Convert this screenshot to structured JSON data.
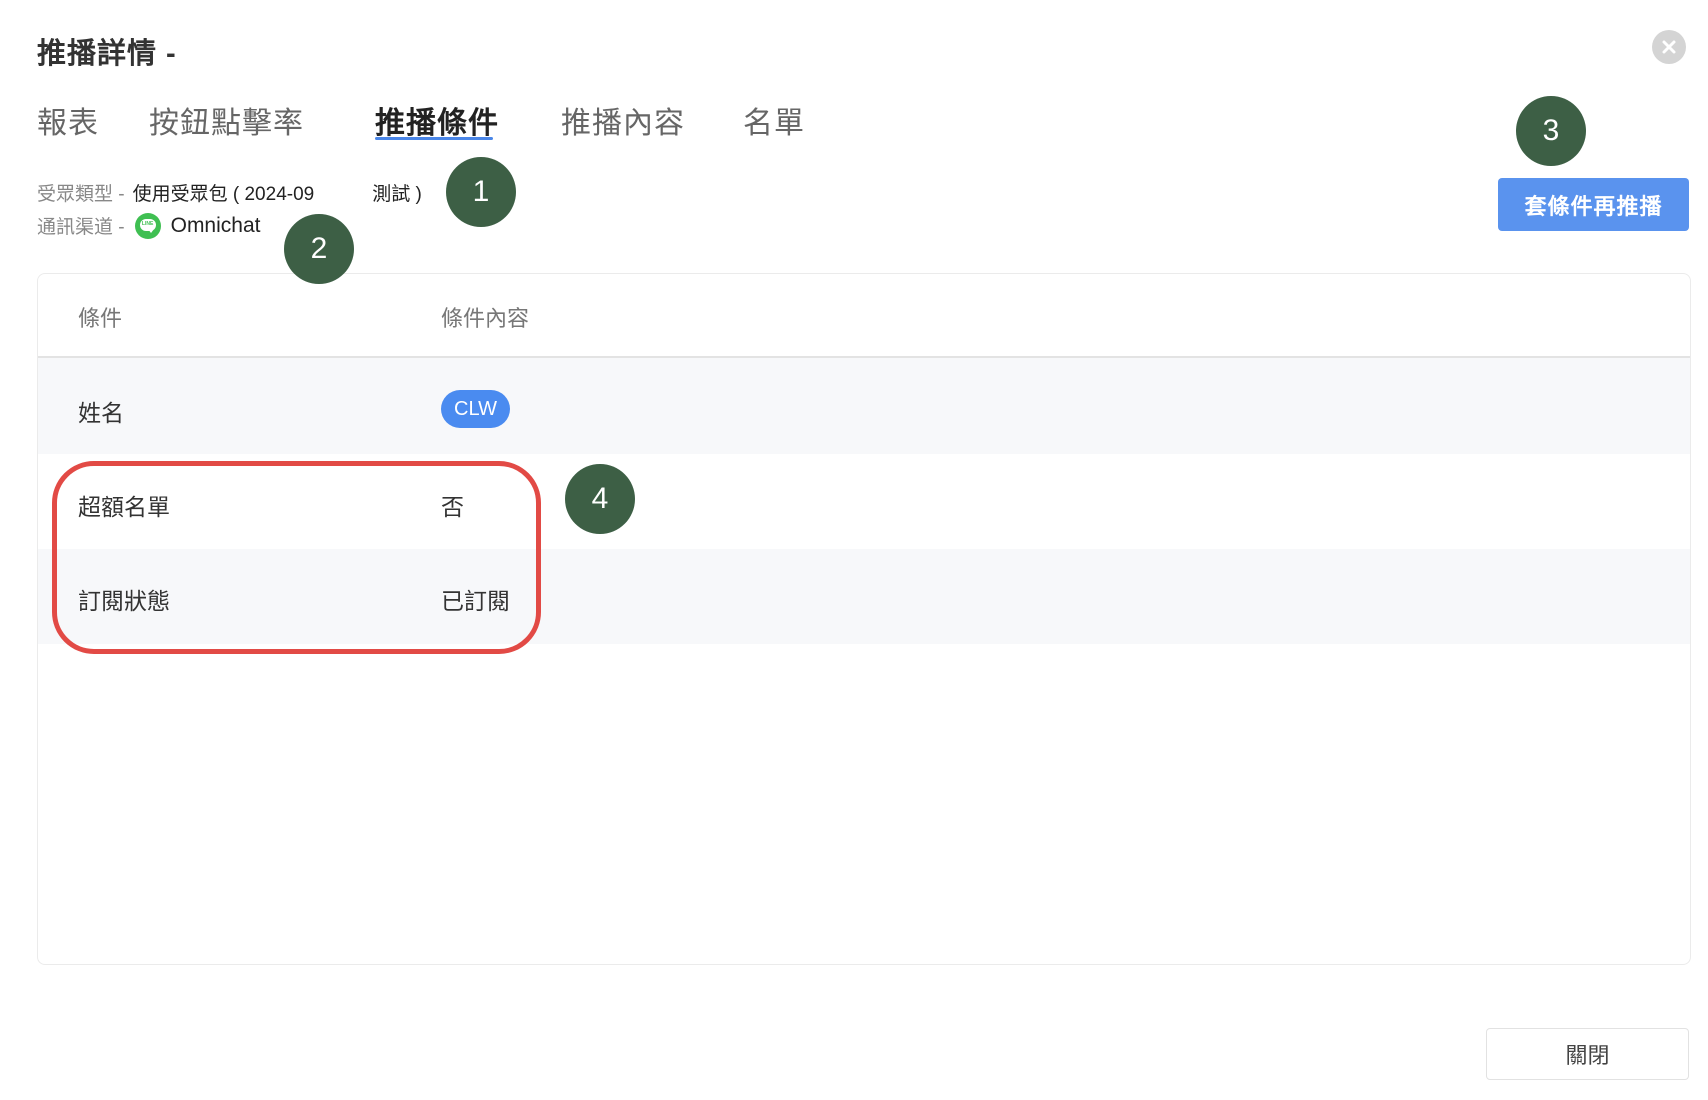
{
  "dialog": {
    "title": "推播詳情 -"
  },
  "tabs": [
    {
      "label": "報表",
      "active": false
    },
    {
      "label": "按鈕點擊率",
      "active": false
    },
    {
      "label": "推播條件",
      "active": true
    },
    {
      "label": "推播內容",
      "active": false
    },
    {
      "label": "名單",
      "active": false
    }
  ],
  "meta": {
    "audience_label": "受眾類型 -",
    "audience_value": "使用受眾包 ( 2024-09",
    "audience_suffix": "測試 )",
    "channel_label": "通訊渠道 -",
    "channel_icon": "line-icon",
    "channel_icon_text": "LINE",
    "channel_value": "Omnichat"
  },
  "actions": {
    "repush_label": "套條件再推播",
    "close_label": "關閉"
  },
  "table": {
    "headers": [
      "條件",
      "條件內容"
    ],
    "rows": [
      {
        "condition": "姓名",
        "content": "CLW",
        "as_tag": true
      },
      {
        "condition": "超額名單",
        "content": "否",
        "as_tag": false
      },
      {
        "condition": "訂閱狀態",
        "content": "已訂閱",
        "as_tag": false
      }
    ]
  },
  "callouts": [
    "1",
    "2",
    "3",
    "4"
  ],
  "colors": {
    "primary": "#5a93ee",
    "tag": "#4a8bf0",
    "callout": "#3d5f45",
    "highlight": "#e24a45",
    "line_green": "#3fbf52"
  }
}
